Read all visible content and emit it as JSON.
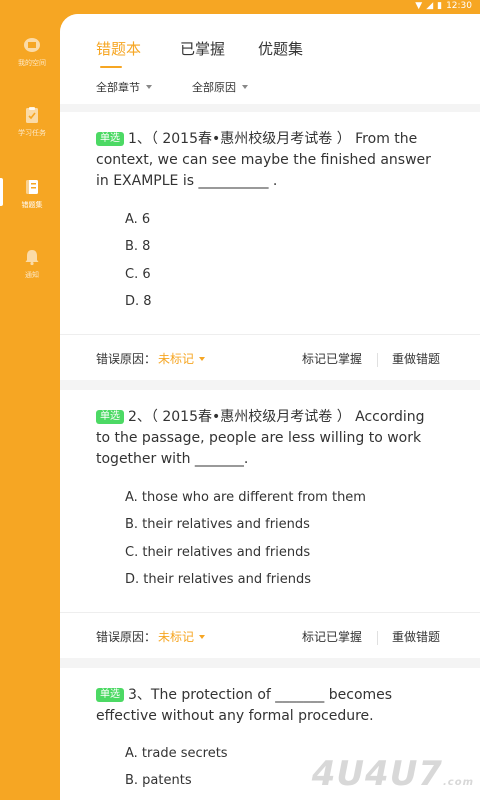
{
  "status_bar": {
    "time": "12:30",
    "icons": [
      "wifi-icon",
      "signal-icon",
      "battery-icon"
    ]
  },
  "sidebar": {
    "items": [
      {
        "label": "我的空间",
        "icon": "space-icon"
      },
      {
        "label": "学习任务",
        "icon": "task-icon"
      },
      {
        "label": "错题集",
        "icon": "notebook-icon",
        "active": true
      },
      {
        "label": "通知",
        "icon": "bell-icon"
      }
    ]
  },
  "tabs": [
    {
      "label": "错题本",
      "active": true
    },
    {
      "label": "已掌握"
    },
    {
      "label": "优题集"
    }
  ],
  "filters": [
    {
      "label": "全部章节"
    },
    {
      "label": "全部原因"
    }
  ],
  "questions": [
    {
      "badge": "单选",
      "text": "1、（ 2015春•惠州校级月考试卷 ） From the context, we can see maybe the finished answer in EXAMPLE is __________ .",
      "options": [
        "A. 6",
        "B. 8",
        "C. 6",
        "D. 8"
      ],
      "reason_label": "错误原因：",
      "reason_value": "未标记",
      "mark_label": "标记已掌握",
      "redo_label": "重做错题"
    },
    {
      "badge": "单选",
      "text": "2、（ 2015春•惠州校级月考试卷 ） According to the passage, people are less willing to work together with _______.",
      "options": [
        "A. those who are different from them",
        "B. their relatives and friends",
        "C. their relatives and friends",
        "D. their relatives and friends"
      ],
      "reason_label": "错误原因：",
      "reason_value": "未标记",
      "mark_label": "标记已掌握",
      "redo_label": "重做错题"
    },
    {
      "badge": "单选",
      "text": "3、The protection of _______ becomes effective without any formal procedure.",
      "options": [
        "A. trade secrets",
        "B. patents"
      ]
    }
  ],
  "watermark": {
    "text": "4U4U7",
    "suffix": ".com"
  },
  "colors": {
    "accent": "#f6a623",
    "badge": "#4cd964",
    "background": "#f4f4f4"
  }
}
